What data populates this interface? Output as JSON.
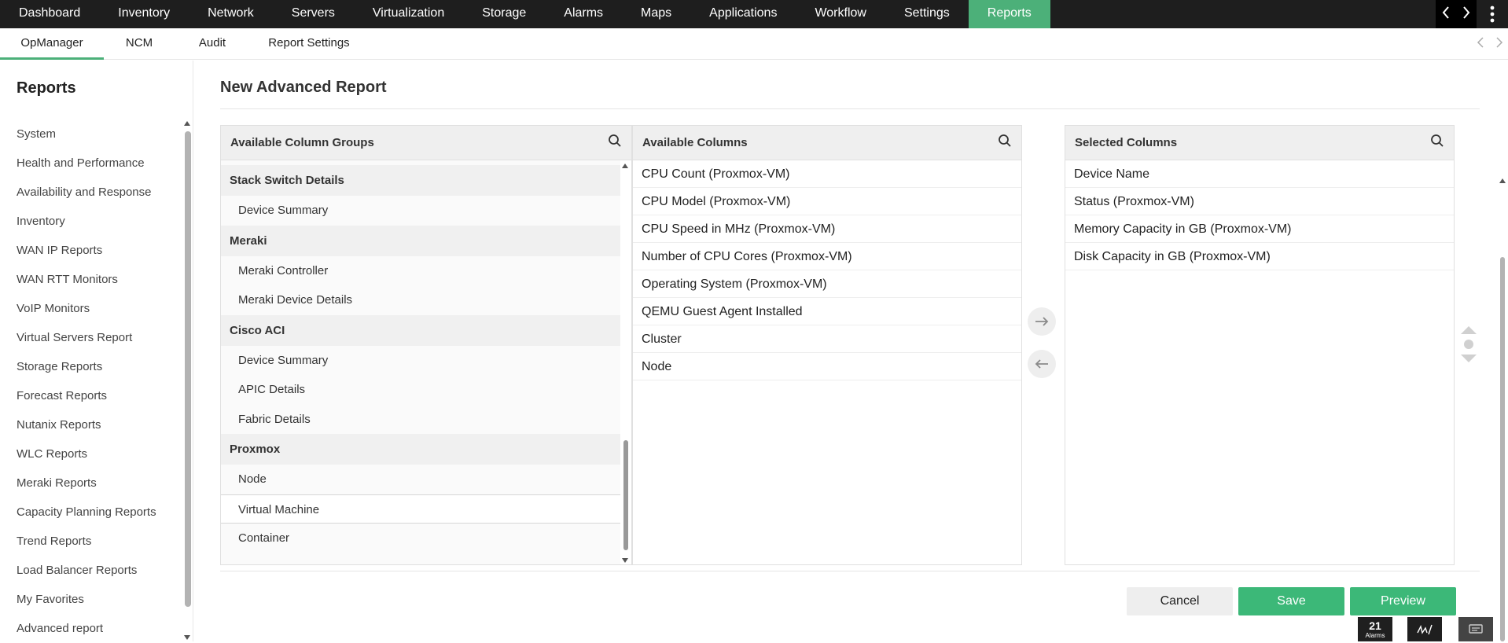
{
  "topnav": {
    "items": [
      "Dashboard",
      "Inventory",
      "Network",
      "Servers",
      "Virtualization",
      "Storage",
      "Alarms",
      "Maps",
      "Applications",
      "Workflow",
      "Settings",
      "Reports"
    ],
    "active_index": 11,
    "accent": "#4cb079"
  },
  "subnav": {
    "tabs": [
      "OpManager",
      "NCM",
      "Audit",
      "Report Settings"
    ],
    "active_index": 0
  },
  "sidebar": {
    "title": "Reports",
    "items": [
      "System",
      "Health and Performance",
      "Availability and Response",
      "Inventory",
      "WAN IP Reports",
      "WAN RTT Monitors",
      "VoIP Monitors",
      "Virtual Servers Report",
      "Storage Reports",
      "Forecast Reports",
      "Nutanix Reports",
      "WLC Reports",
      "Meraki Reports",
      "Capacity Planning Reports",
      "Trend Reports",
      "Load Balancer Reports",
      "My Favorites",
      "Advanced report"
    ]
  },
  "page": {
    "title": "New Advanced Report"
  },
  "groups_panel": {
    "title": "Available Column Groups",
    "groups": [
      {
        "name": "Stack Switch Details",
        "items": [
          "Device Summary"
        ]
      },
      {
        "name": "Meraki",
        "items": [
          "Meraki Controller",
          "Meraki Device Details"
        ]
      },
      {
        "name": "Cisco ACI",
        "items": [
          "Device Summary",
          "APIC Details",
          "Fabric Details"
        ]
      },
      {
        "name": "Proxmox",
        "items": [
          "Node",
          "Virtual Machine",
          "Container"
        ]
      }
    ],
    "selected": "Virtual Machine"
  },
  "available_panel": {
    "title": "Available Columns",
    "items": [
      "CPU Count (Proxmox-VM)",
      "CPU Model (Proxmox-VM)",
      "CPU Speed in MHz (Proxmox-VM)",
      "Number of CPU Cores (Proxmox-VM)",
      "Operating System (Proxmox-VM)",
      "QEMU Guest Agent Installed",
      "Cluster",
      "Node"
    ]
  },
  "selected_panel": {
    "title": "Selected Columns",
    "items": [
      "Device Name",
      "Status (Proxmox-VM)",
      "Memory Capacity in GB (Proxmox-VM)",
      "Disk Capacity in GB (Proxmox-VM)"
    ]
  },
  "buttons": {
    "cancel": "Cancel",
    "save": "Save",
    "preview": "Preview"
  },
  "dock": {
    "alarm_count": "21",
    "alarm_label": "Alarms"
  }
}
